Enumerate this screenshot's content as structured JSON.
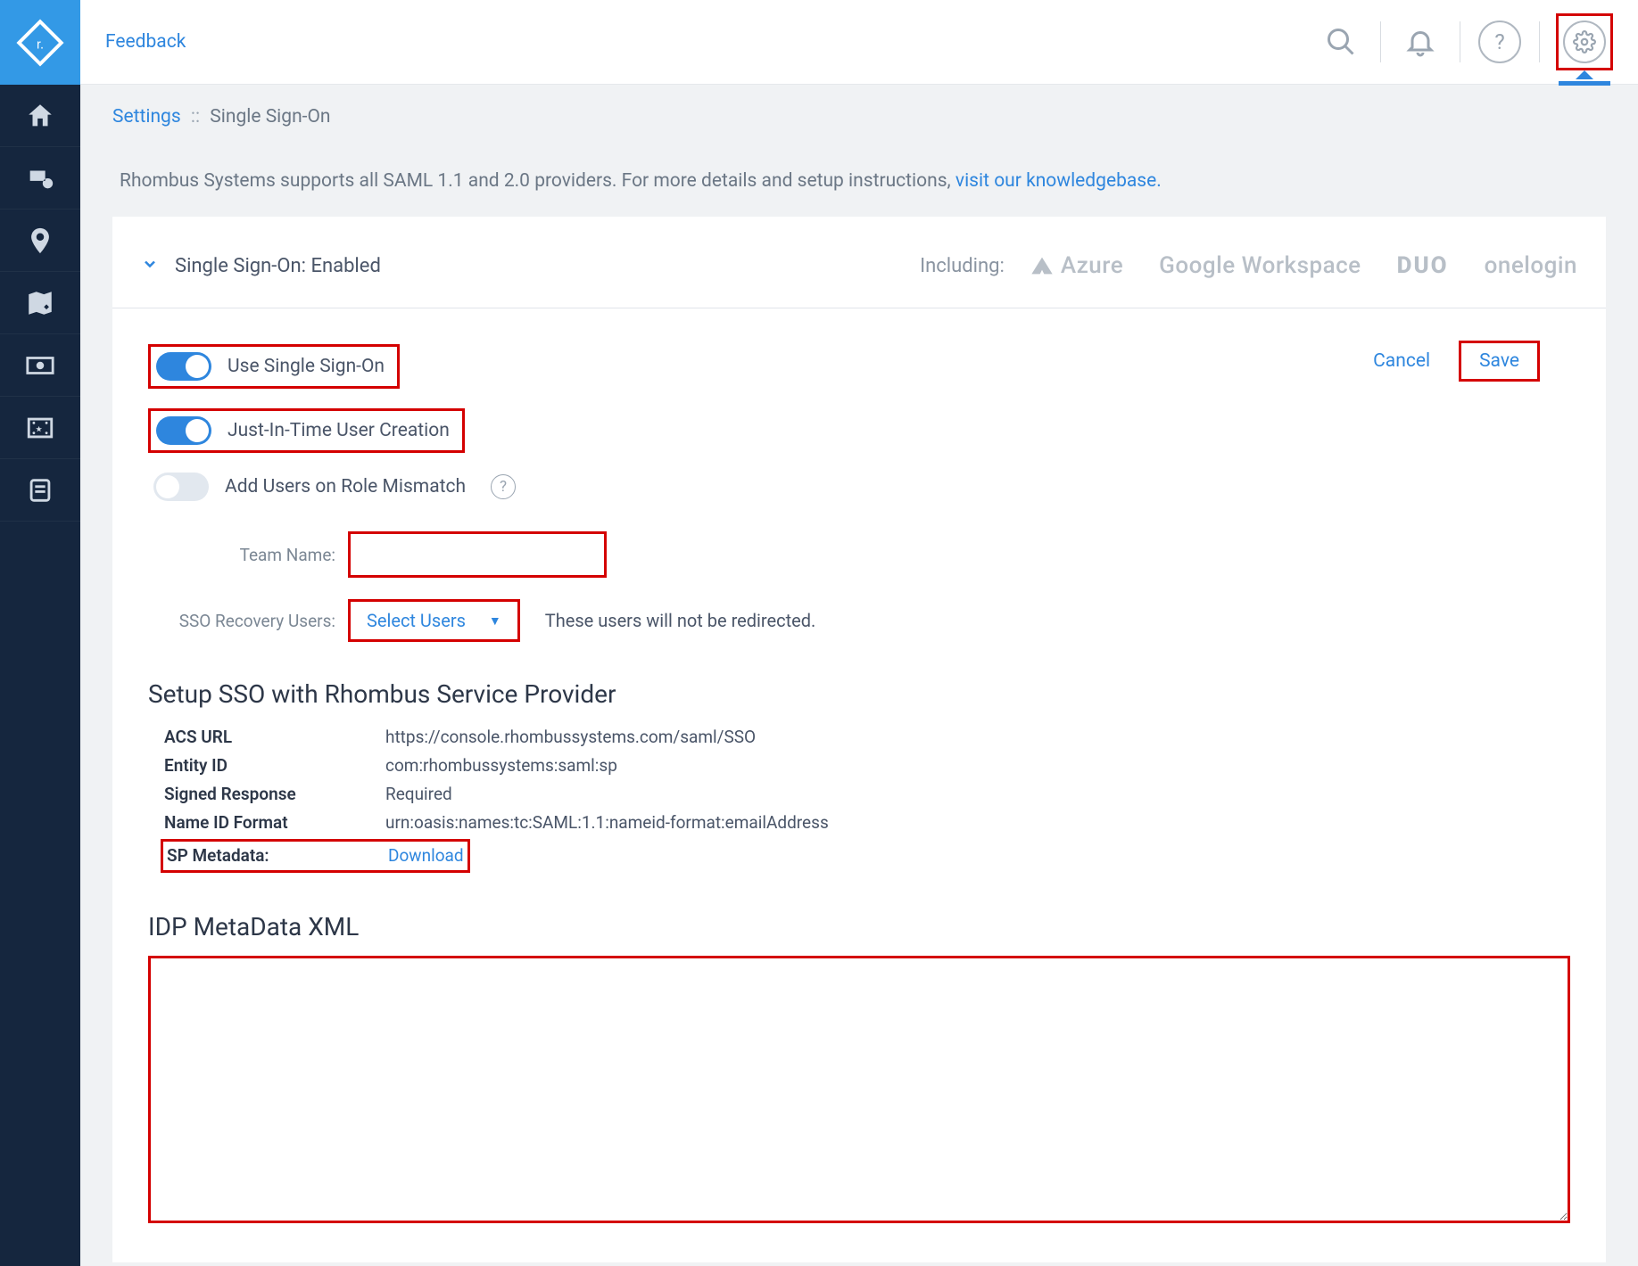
{
  "header": {
    "feedback": "Feedback"
  },
  "breadcrumb": {
    "settings": "Settings",
    "separator": "::",
    "current": "Single Sign-On"
  },
  "info": {
    "prefix": "Rhombus Systems supports all SAML 1.1 and 2.0 providers. For more details and setup instructions, ",
    "link": "visit our knowledgebase."
  },
  "sso": {
    "title": "Single Sign-On: Enabled",
    "including_label": "Including:",
    "providers": {
      "azure": "Azure",
      "google": "Google Workspace",
      "duo": "DUO",
      "onelogin": "onelogin"
    }
  },
  "toggles": {
    "use_sso": "Use Single Sign-On",
    "jit": "Just-In-Time User Creation",
    "role_mismatch": "Add Users on Role Mismatch"
  },
  "actions": {
    "cancel": "Cancel",
    "save": "Save"
  },
  "fields": {
    "team_name_label": "Team Name:",
    "team_name_value": "",
    "recovery_label": "SSO Recovery Users:",
    "recovery_select_placeholder": "Select Users",
    "recovery_helper": "These users will not be redirected."
  },
  "sp": {
    "section_title": "Setup SSO with Rhombus Service Provider",
    "rows": {
      "acs_url_k": "ACS URL",
      "acs_url_v": "https://console.rhombussystems.com/saml/SSO",
      "entity_k": "Entity ID",
      "entity_v": "com:rhombussystems:saml:sp",
      "signed_k": "Signed Response",
      "signed_v": "Required",
      "nameid_k": "Name ID Format",
      "nameid_v": "urn:oasis:names:tc:SAML:1.1:nameid-format:emailAddress",
      "meta_k": "SP Metadata:",
      "meta_v": "Download"
    }
  },
  "idp": {
    "title": "IDP MetaData XML",
    "value": ""
  },
  "colors": {
    "accent": "#2e86de",
    "highlight": "#d40000",
    "sidebar": "#15263e"
  }
}
